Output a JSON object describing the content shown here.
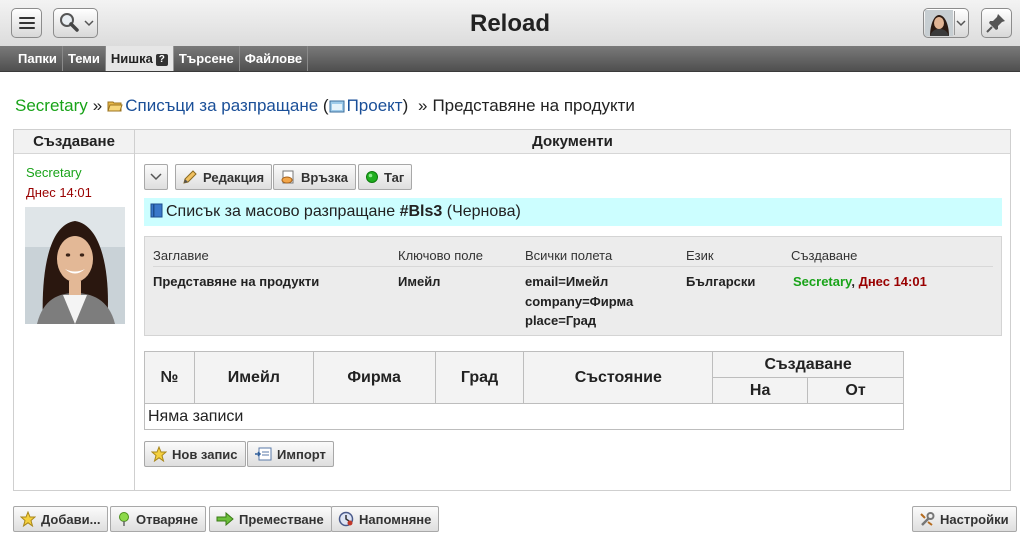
{
  "header": {
    "title": "Reload"
  },
  "tabs": [
    {
      "label": "Папки"
    },
    {
      "label": "Теми"
    },
    {
      "label": "Нишка",
      "help": "?"
    },
    {
      "label": "Търсене"
    },
    {
      "label": "Файлове"
    }
  ],
  "breadcrumb": {
    "user": "Secretary",
    "sep1": "»",
    "folder": "Списъци за разпращане",
    "paren_open": "(",
    "project": "Проект",
    "paren_close": ")",
    "sep2": "»",
    "current": "Представяне на продукти"
  },
  "left_column": {
    "header": "Създаване",
    "author": "Secretary",
    "date": "Днес 14:01"
  },
  "right_column": {
    "header": "Документи"
  },
  "toolbar": {
    "edit": "Редакция",
    "link": "Връзка",
    "tag": "Таг"
  },
  "document": {
    "type_label": "Списък за масово разпращане",
    "number": "#Bls3",
    "status": "(Чернова)"
  },
  "info": {
    "headers": {
      "title": "Заглавие",
      "key_field": "Ключово поле",
      "all_fields": "Всички полета",
      "language": "Език",
      "created": "Създаване"
    },
    "values": {
      "title": "Представяне на продукти",
      "key_field": "Имейл",
      "all_fields": [
        "email=Имейл",
        "company=Фирма",
        "place=Град"
      ],
      "language": "Български",
      "created_by": "Secretary",
      "created_sep": ",",
      "created_at": "Днес 14:01"
    }
  },
  "records": {
    "columns": {
      "num": "№",
      "email": "Имейл",
      "company": "Фирма",
      "city": "Град",
      "state": "Състояние",
      "created": "Създаване",
      "created_on": "На",
      "created_from": "От"
    },
    "empty": "Няма записи",
    "new_button": "Нов запис",
    "import_button": "Импорт"
  },
  "footer": {
    "add": "Добави...",
    "open": "Отваряне",
    "move": "Преместване",
    "remind": "Напомняне",
    "settings": "Настройки"
  }
}
